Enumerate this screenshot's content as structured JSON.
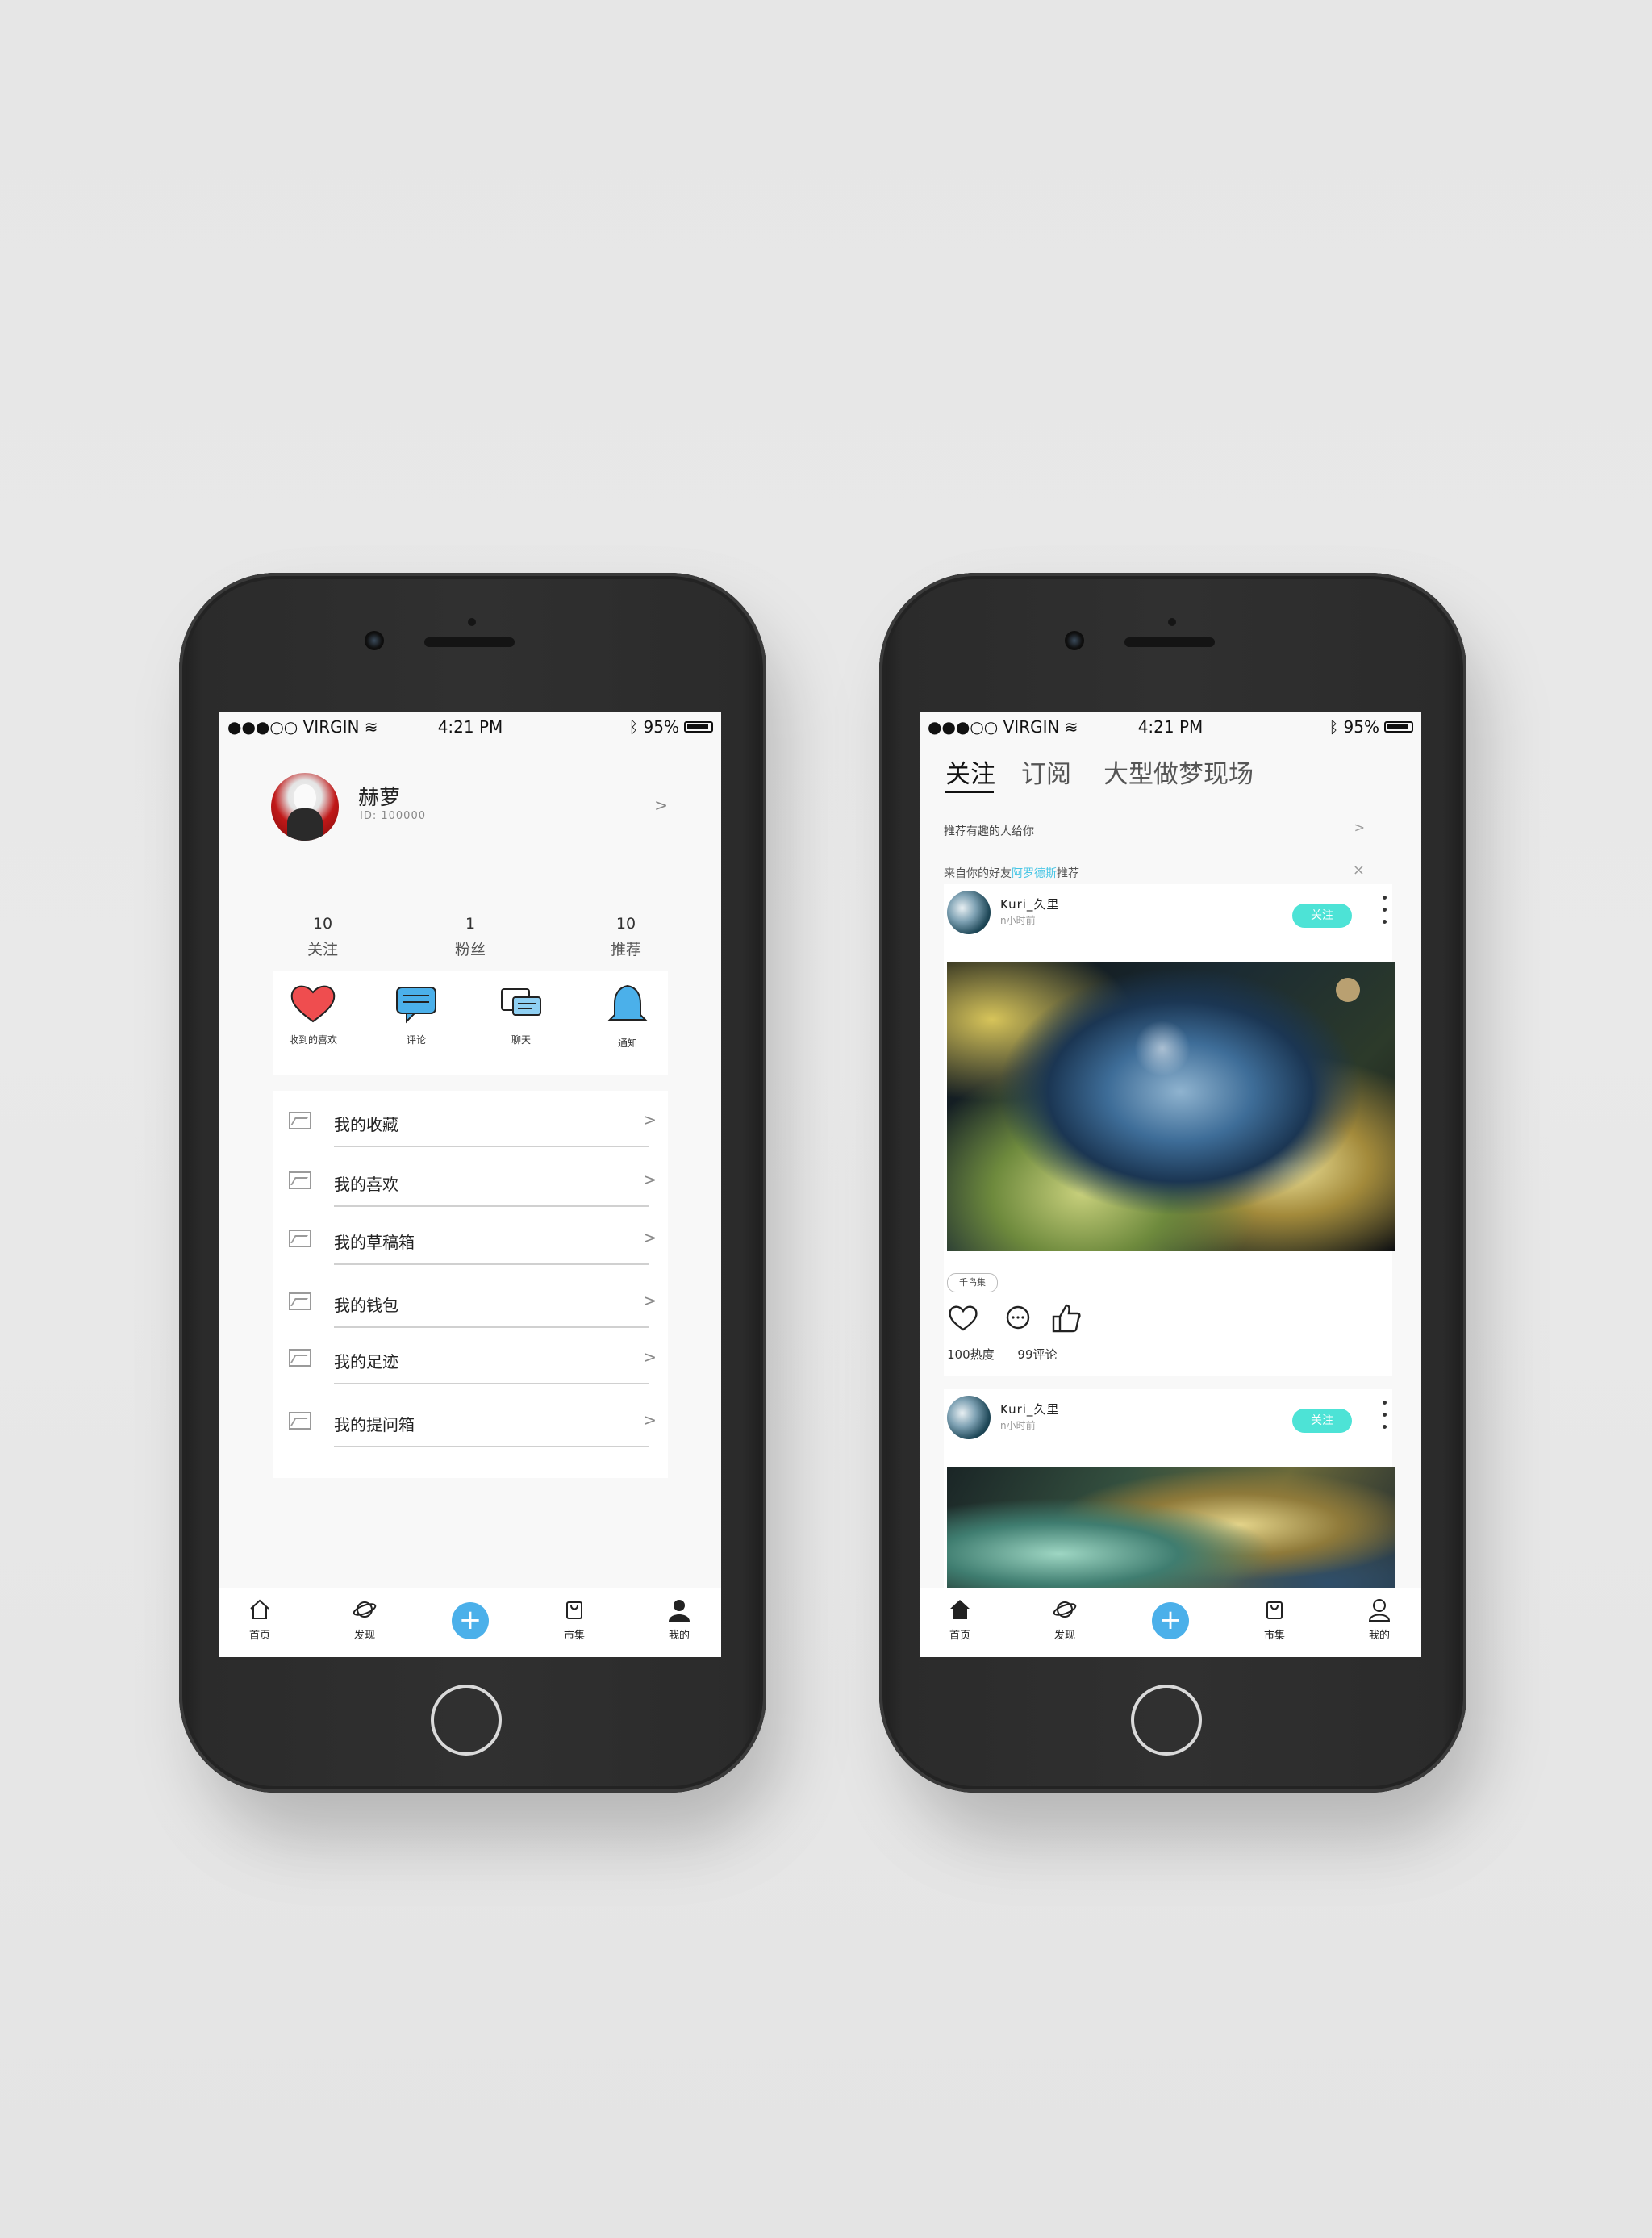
{
  "status": {
    "carrier": "●●●○○ VIRGIN",
    "time": "4:21 PM",
    "battery": "95%"
  },
  "profile_screen": {
    "name": "赫萝",
    "id": "ID: 100000",
    "stats": [
      {
        "num": "10",
        "label": "关注"
      },
      {
        "num": "1",
        "label": "粉丝"
      },
      {
        "num": "10",
        "label": "推荐"
      }
    ],
    "quick": [
      {
        "label": "收到的喜欢",
        "icon": "heart-icon"
      },
      {
        "label": "评论",
        "icon": "comment-icon"
      },
      {
        "label": "聊天",
        "icon": "chat-icon"
      },
      {
        "label": "通知",
        "icon": "bell-icon"
      }
    ],
    "menu": [
      "我的收藏",
      "我的喜欢",
      "我的草稿箱",
      "我的钱包",
      "我的足迹",
      "我的提问箱"
    ]
  },
  "feed_screen": {
    "tabs": [
      "关注",
      "订阅",
      "大型做梦现场"
    ],
    "recommend": "推荐有趣的人给你",
    "from_prefix": "来自你的好友",
    "from_friend": "阿罗德斯",
    "from_suffix": "推荐",
    "posts": [
      {
        "user": "Kuri_久里",
        "time": "n小时前",
        "follow": "关注",
        "tag": "千鸟集",
        "heat": "100热度",
        "comments": "99评论"
      },
      {
        "user": "Kuri_久里",
        "time": "n小时前",
        "follow": "关注"
      }
    ]
  },
  "tabbar": {
    "home": "首页",
    "discover": "发现",
    "market": "市集",
    "me": "我的"
  },
  "colors": {
    "accent_blue": "#4bb0ea",
    "follow_teal": "#4de3d6",
    "link_cyan": "#49c6e5",
    "heart_red": "#ef4d4f"
  }
}
